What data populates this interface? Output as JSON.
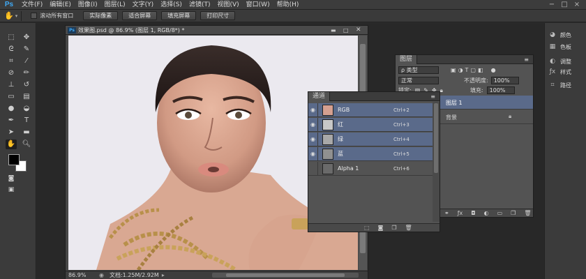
{
  "app": {
    "logo": "Ps"
  },
  "menu": [
    "文件(F)",
    "编辑(E)",
    "图像(I)",
    "图层(L)",
    "文字(Y)",
    "选择(S)",
    "滤镜(T)",
    "视图(V)",
    "窗口(W)",
    "帮助(H)"
  ],
  "window_controls": [
    "−",
    "□",
    "×"
  ],
  "options_bar": {
    "scroll_all_label": "滚动所有窗口",
    "buttons": [
      "实际像素",
      "适合屏幕",
      "填充屏幕",
      "打印尺寸"
    ]
  },
  "document": {
    "tab_title": "效果图.psd @ 86.9% (图层 1, RGB/8*) *",
    "zoom": "86.9%",
    "doc_info": "文档:1.25M/2.92M"
  },
  "layers_panel": {
    "tab": "图层",
    "filter_kind": "ρ 类型",
    "blend_mode": "正常",
    "opacity_label": "不透明度:",
    "opacity": "100%",
    "lock_label": "锁定:",
    "fill_label": "填充:",
    "fill": "100%",
    "layers": [
      {
        "name": "图层 1",
        "selected": true
      },
      {
        "name": "背景",
        "selected": false
      }
    ]
  },
  "channels_panel": {
    "tab": "通道",
    "channels": [
      {
        "name": "RGB",
        "shortcut": "Ctrl+2",
        "visible": true,
        "selected": true
      },
      {
        "name": "红",
        "shortcut": "Ctrl+3",
        "visible": true,
        "selected": true
      },
      {
        "name": "绿",
        "shortcut": "Ctrl+4",
        "visible": true,
        "selected": true
      },
      {
        "name": "蓝",
        "shortcut": "Ctrl+5",
        "visible": true,
        "selected": true
      },
      {
        "name": "Alpha 1",
        "shortcut": "Ctrl+6",
        "visible": false,
        "selected": false
      }
    ]
  },
  "dock": [
    {
      "label": "颜色",
      "icon": "color-icon"
    },
    {
      "label": "色板",
      "icon": "swatches-icon"
    },
    {
      "label": "调整",
      "icon": "adjustments-icon"
    },
    {
      "label": "样式",
      "icon": "styles-icon"
    },
    {
      "label": "路径",
      "icon": "paths-icon"
    }
  ],
  "colors": {
    "foreground": "#000000",
    "background": "#ffffff",
    "selection": "#5a6a8a",
    "accent": "#3fa9f5"
  }
}
